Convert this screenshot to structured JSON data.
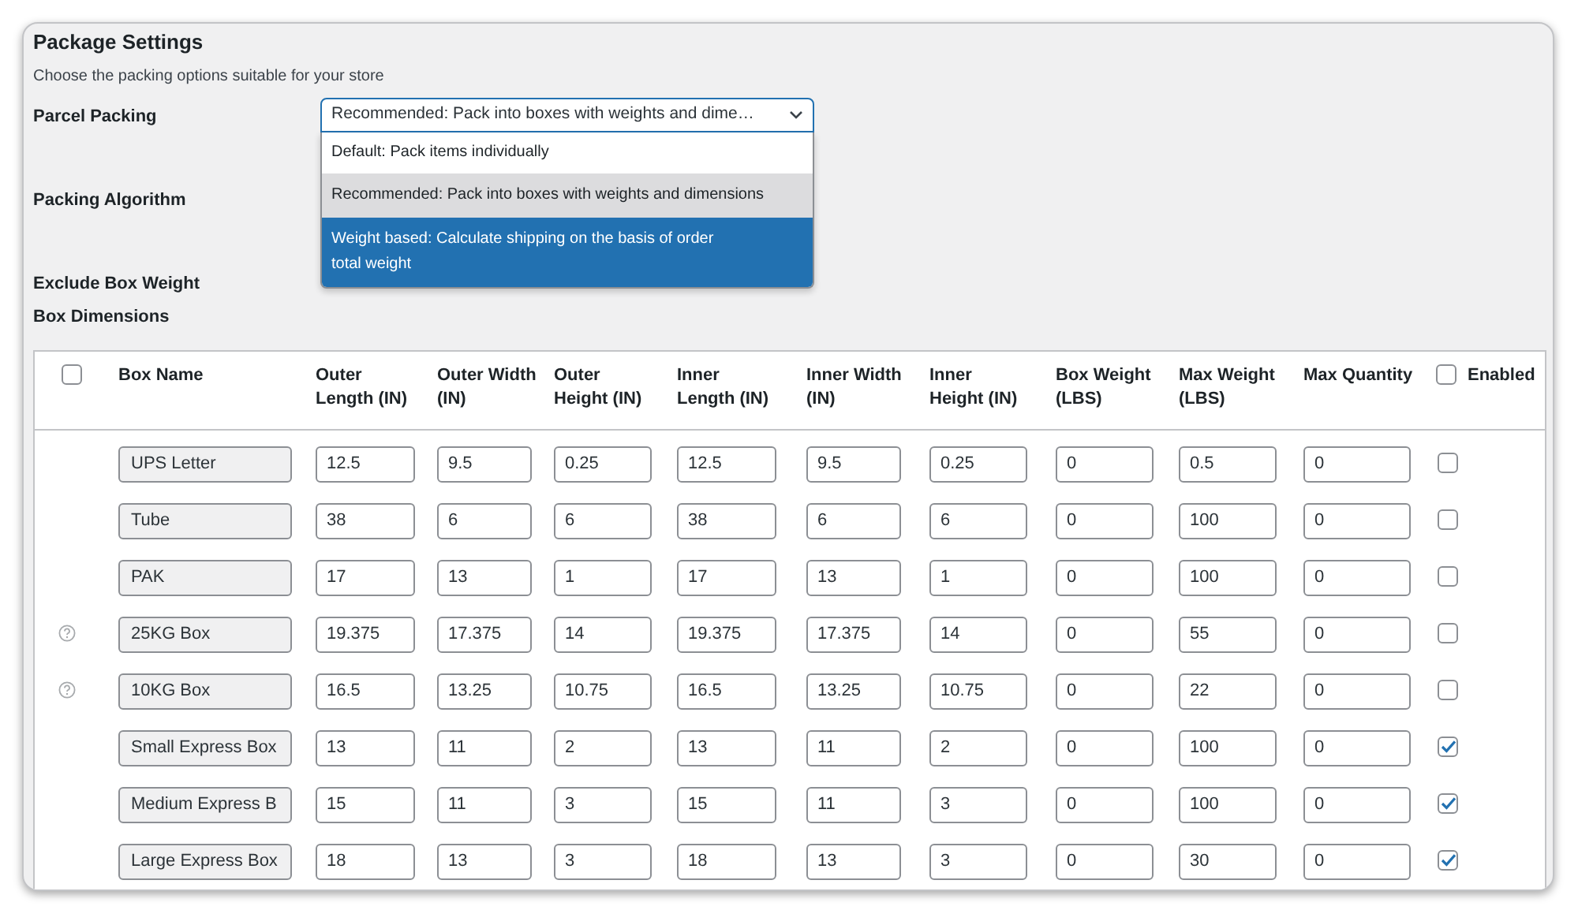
{
  "section": {
    "title": "Package Settings",
    "description": "Choose the packing options suitable for your store"
  },
  "fields": [
    {
      "label": "Parcel Packing"
    },
    {
      "label": "Packing Algorithm"
    },
    {
      "label": "Exclude Box Weight"
    }
  ],
  "parcel_packing_select": {
    "value": "Recommended: Pack into boxes with weights and dime…",
    "expanded": true,
    "options": [
      {
        "label": "Default: Pack items individually",
        "selected": false,
        "hovered": false
      },
      {
        "label": "Recommended: Pack into boxes with weights and dimensions",
        "selected": true,
        "hovered": false
      },
      {
        "label": "Weight based: Calculate shipping on the basis of order total weight",
        "selected": false,
        "hovered": true
      }
    ]
  },
  "box_dimensions": {
    "title": "Box Dimensions",
    "select_all_checked": false,
    "enabled_all_checked": false,
    "columns": [
      "Box Name",
      "Outer Length (IN)",
      "Outer Width (IN)",
      "Outer Height (IN)",
      "Inner Length (IN)",
      "Inner Width (IN)",
      "Inner Height (IN)",
      "Box Weight (LBS)",
      "Max Weight (LBS)",
      "Max Quantity",
      "Enabled"
    ],
    "rows": [
      {
        "help": false,
        "name": "UPS Letter",
        "values": [
          "12.5",
          "9.5",
          "0.25",
          "12.5",
          "9.5",
          "0.25",
          "0",
          "0.5",
          "0"
        ],
        "enabled": false
      },
      {
        "help": false,
        "name": "Tube",
        "values": [
          "38",
          "6",
          "6",
          "38",
          "6",
          "6",
          "0",
          "100",
          "0"
        ],
        "enabled": false
      },
      {
        "help": false,
        "name": "PAK",
        "values": [
          "17",
          "13",
          "1",
          "17",
          "13",
          "1",
          "0",
          "100",
          "0"
        ],
        "enabled": false
      },
      {
        "help": true,
        "name": "25KG Box",
        "values": [
          "19.375",
          "17.375",
          "14",
          "19.375",
          "17.375",
          "14",
          "0",
          "55",
          "0"
        ],
        "enabled": false
      },
      {
        "help": true,
        "name": "10KG Box",
        "values": [
          "16.5",
          "13.25",
          "10.75",
          "16.5",
          "13.25",
          "10.75",
          "0",
          "22",
          "0"
        ],
        "enabled": false
      },
      {
        "help": false,
        "name": "Small Express Box",
        "values": [
          "13",
          "11",
          "2",
          "13",
          "11",
          "2",
          "0",
          "100",
          "0"
        ],
        "enabled": true
      },
      {
        "help": false,
        "name": "Medium Express B",
        "values": [
          "15",
          "11",
          "3",
          "15",
          "11",
          "3",
          "0",
          "100",
          "0"
        ],
        "enabled": true
      },
      {
        "help": false,
        "name": "Large Express Box",
        "values": [
          "18",
          "13",
          "3",
          "18",
          "13",
          "3",
          "0",
          "30",
          "0"
        ],
        "enabled": true
      }
    ]
  }
}
